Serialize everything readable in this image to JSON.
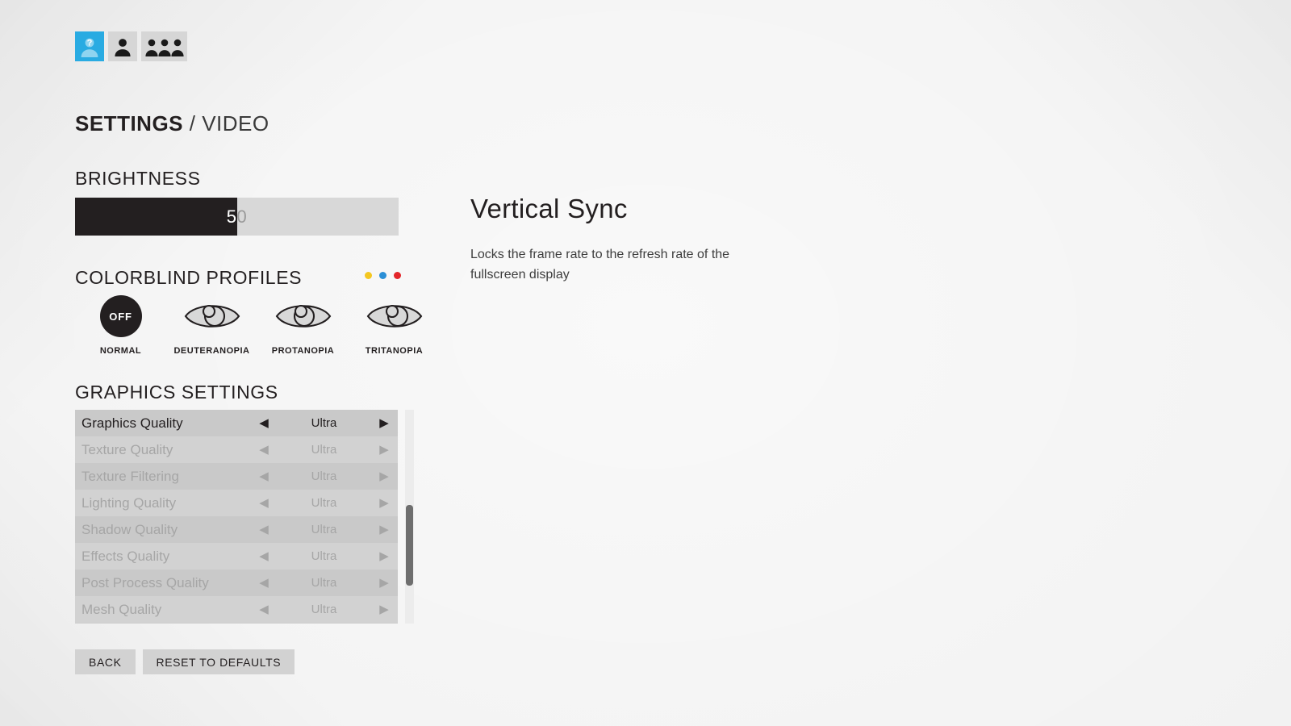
{
  "tabs": [
    {
      "id": "tab-help-profile",
      "icon": "person-question-icon",
      "active": true
    },
    {
      "id": "tab-single-player",
      "icon": "person-icon",
      "active": false
    },
    {
      "id": "tab-multiplayer",
      "icon": "people-group-icon",
      "active": false
    }
  ],
  "title": {
    "primary": "SETTINGS",
    "separator": " / ",
    "secondary": "VIDEO"
  },
  "brightness": {
    "heading": "BRIGHTNESS",
    "value": "50",
    "percent": 50
  },
  "colorblind": {
    "heading": "COLORBLIND PROFILES",
    "dots": [
      {
        "name": "yellow-dot",
        "color": "#F4C720"
      },
      {
        "name": "blue-dot",
        "color": "#2B8FD6"
      },
      {
        "name": "red-dot",
        "color": "#E3262A"
      }
    ],
    "profiles": [
      {
        "label": "NORMAL",
        "icon": "off-circle-icon",
        "badge": "OFF",
        "selected": true
      },
      {
        "label": "DEUTERANOPIA",
        "icon": "eye-icon",
        "badge": "",
        "selected": false
      },
      {
        "label": "PROTANOPIA",
        "icon": "eye-icon",
        "badge": "",
        "selected": false
      },
      {
        "label": "TRITANOPIA",
        "icon": "eye-icon",
        "badge": "",
        "selected": false
      }
    ]
  },
  "graphics": {
    "heading": "GRAPHICS SETTINGS",
    "left_arrow": "◀",
    "right_arrow": "▶",
    "rows": [
      {
        "label": "Graphics Quality",
        "value": "Ultra",
        "enabled": true
      },
      {
        "label": "Texture Quality",
        "value": "Ultra",
        "enabled": false
      },
      {
        "label": "Texture Filtering",
        "value": "Ultra",
        "enabled": false
      },
      {
        "label": "Lighting Quality",
        "value": "Ultra",
        "enabled": false
      },
      {
        "label": "Shadow Quality",
        "value": "Ultra",
        "enabled": false
      },
      {
        "label": "Effects Quality",
        "value": "Ultra",
        "enabled": false
      },
      {
        "label": "Post Process Quality",
        "value": "Ultra",
        "enabled": false
      },
      {
        "label": "Mesh Quality",
        "value": "Ultra",
        "enabled": false
      }
    ]
  },
  "buttons": {
    "back": "BACK",
    "reset": "RESET TO DEFAULTS"
  },
  "detail": {
    "title": "Vertical Sync",
    "description": "Locks the frame rate to the refresh rate of the fullscreen display"
  },
  "colors": {
    "accent": "#29ABE2",
    "background": "#f2f2f2",
    "ink": "#231f20",
    "disabled": "#a6a6a6"
  }
}
